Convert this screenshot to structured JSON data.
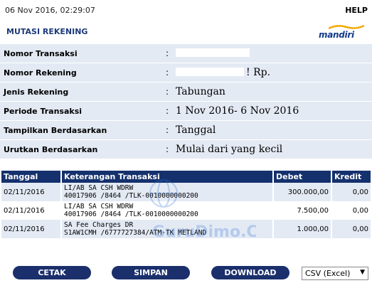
{
  "header": {
    "datetime": "06 Nov 2016, 02:29:07",
    "help": "HELP",
    "title": "MUTASI REKENING",
    "logo_text": "mandiri"
  },
  "info": [
    {
      "label": "Nomor Transaksi",
      "colon": ":",
      "value": ""
    },
    {
      "label": "Nomor Rekening",
      "colon": ":",
      "value": "! Rp."
    },
    {
      "label": "Jenis Rekening",
      "colon": ":",
      "value": "Tabungan"
    },
    {
      "label": "Periode Transaksi",
      "colon": ":",
      "value": "1 Nov 2016- 6 Nov 2016"
    },
    {
      "label": "Tampilkan Berdasarkan",
      "colon": ":",
      "value": "Tanggal"
    },
    {
      "label": "Urutkan Berdasarkan",
      "colon": ":",
      "value": "Mulai dari yang kecil"
    }
  ],
  "table": {
    "headers": [
      "Tanggal",
      "Keterangan Transaksi",
      "Debet",
      "Kredit"
    ],
    "rows": [
      {
        "date": "02/11/2016",
        "desc1": "LI/AB SA CSH WDRW",
        "desc2": "40017906 /8464 /TLK-0010000000200",
        "debet": "300.000,00",
        "kredit": "0,00"
      },
      {
        "date": "02/11/2016",
        "desc1": "LI/AB SA CSH WDRW",
        "desc2": "40017906 /8464 /TLK-0010000000200",
        "debet": "7.500,00",
        "kredit": "0,00"
      },
      {
        "date": "02/11/2016",
        "desc1": "SA Fee Charges DR",
        "desc2": "S1AW1CMH /6777727384/ATM-TK METLAND",
        "debet": "1.000,00",
        "kredit": "0,00"
      }
    ]
  },
  "watermark": "GuruDimo.COM",
  "buttons": {
    "print": "CETAK",
    "save": "SIMPAN",
    "download": "DOWNLOAD"
  },
  "format_select": {
    "selected": "CSV (Excel)"
  },
  "colors": {
    "header_bg": "#15316d",
    "row_alt": "#e4eaf4",
    "title": "#1e3a7a",
    "button": "#1a2f6b"
  }
}
